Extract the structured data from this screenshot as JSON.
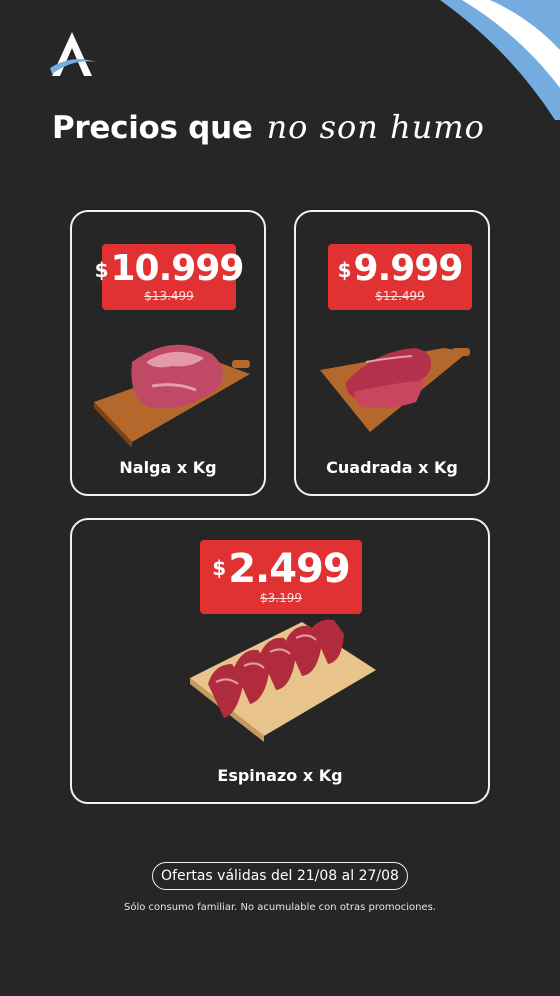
{
  "brand": {
    "logo_icon": "brand-a-logo-icon",
    "flag_icon": "argentina-flag-stripes-icon"
  },
  "header": {
    "title_plain": "Precios que",
    "title_script": "no son humo"
  },
  "products": [
    {
      "currency": "$",
      "price": "10.999",
      "old_price": "$13.499",
      "name": "Nalga x Kg",
      "image": "raw-rump-cut-on-board"
    },
    {
      "currency": "$",
      "price": "9.999",
      "old_price": "$12.499",
      "name": "Cuadrada x Kg",
      "image": "sliced-round-cut-on-board"
    },
    {
      "currency": "$",
      "price": "2.499",
      "old_price": "$3.199",
      "name": "Espinazo x Kg",
      "image": "backbone-cuts-on-board"
    }
  ],
  "footer": {
    "validity": "Ofertas válidas del 21/08 al 27/08",
    "disclaimer": "Sólo consumo familiar. No acumulable con otras promociones."
  },
  "colors": {
    "background": "#262626",
    "price_tag": "#e03232",
    "flag_blue": "#74acdf",
    "text": "#ffffff"
  }
}
